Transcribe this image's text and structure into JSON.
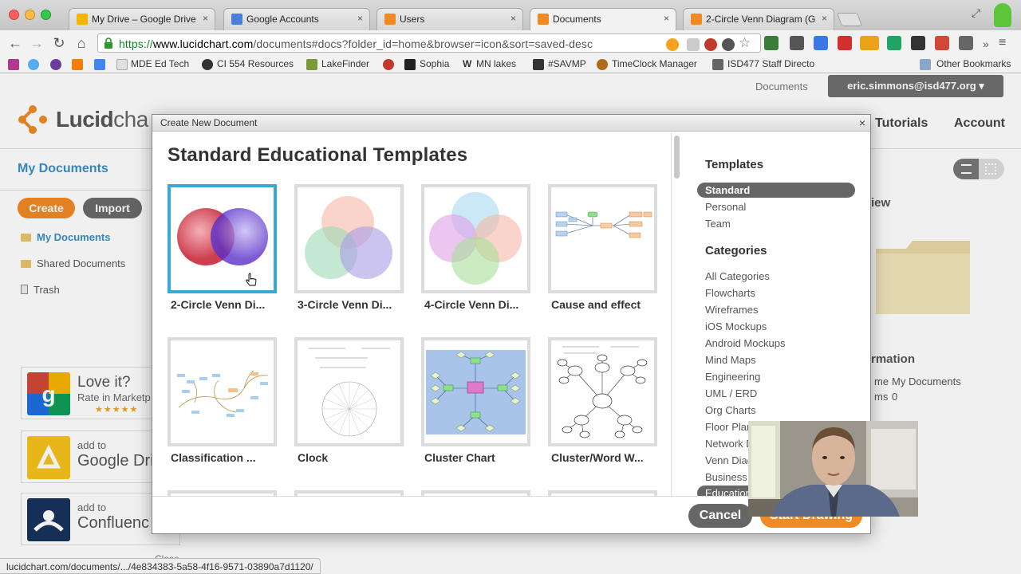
{
  "browser": {
    "tabs": [
      {
        "label": "My Drive – Google Drive",
        "favicon_color": "#f4b400"
      },
      {
        "label": "Google Accounts",
        "favicon_color": "#4a7fd8"
      },
      {
        "label": "Users",
        "favicon_color": "#f08a24"
      },
      {
        "label": "Documents",
        "favicon_color": "#f08a24",
        "active": true
      },
      {
        "label": "2-Circle Venn Diagram (G",
        "favicon_color": "#f08a24"
      }
    ],
    "url": {
      "scheme": "https://",
      "host": "www.lucidchart.com",
      "path": "/documents#docs?folder_id=home&browser=icon&sort=saved-desc"
    },
    "bookmarks": [
      {
        "label": "MDE Ed Tech",
        "icon": "page-icon"
      },
      {
        "label": "CI 554 Resources",
        "icon": "s-icon"
      },
      {
        "label": "LakeFinder",
        "icon": "lake-icon"
      },
      {
        "label": "",
        "icon": "red-icon"
      },
      {
        "label": "Sophia",
        "icon": "sophia-icon"
      },
      {
        "label": "MN lakes",
        "icon": "w-icon"
      },
      {
        "label": "#SAVMP",
        "icon": "savmp-icon"
      },
      {
        "label": "TimeClock Manager",
        "icon": "clock-icon"
      },
      {
        "label": "ISD477 Staff Directo",
        "icon": "isd-icon"
      }
    ],
    "other_bookmarks": "Other Bookmarks",
    "status_url": "lucidchart.com/documents/.../4e834383-5a58-4f16-9571-03890a7d1120/"
  },
  "page": {
    "docs_link": "Documents",
    "user_email": "eric.simmons@isd477.org ▾",
    "logo": {
      "bold": "Lucid",
      "thin": "cha"
    },
    "nav": {
      "tutorials": "Tutorials",
      "account": "Account"
    },
    "sidebar": {
      "title": "My Documents",
      "create": "Create",
      "import": "Import",
      "items": [
        {
          "label": "My Documents"
        },
        {
          "label": "Shared Documents"
        },
        {
          "label": "Trash"
        }
      ],
      "promos": [
        {
          "small": "Love it?",
          "big_small": "Rate in Marketp",
          "stars": "★★★★★"
        },
        {
          "small": "add to",
          "big": "Google Dri"
        },
        {
          "small": "add to",
          "big": "Confluenc"
        }
      ],
      "close_frag": "Close"
    },
    "right": {
      "view_frag": "iew",
      "info_title_frag": "rmation",
      "name_label_frag": "me",
      "name_value": "My Documents",
      "items_label_frag": "ms",
      "items_value": "0"
    }
  },
  "modal": {
    "titlebar": "Create New Document",
    "close": "×",
    "heading": "Standard Educational Templates",
    "templates": [
      {
        "label": "2-Circle Venn Di...",
        "kind": "venn2",
        "selected": true
      },
      {
        "label": "3-Circle Venn Di...",
        "kind": "venn3"
      },
      {
        "label": "4-Circle Venn Di...",
        "kind": "venn4"
      },
      {
        "label": "Cause and effect",
        "kind": "cause"
      },
      {
        "label": "Classification ...",
        "kind": "classification"
      },
      {
        "label": "Clock",
        "kind": "clock"
      },
      {
        "label": "Cluster Chart",
        "kind": "cluster"
      },
      {
        "label": "Cluster/Word W...",
        "kind": "word"
      }
    ],
    "sidebar": {
      "templates_head": "Templates",
      "template_types": [
        "Standard",
        "Personal",
        "Team"
      ],
      "categories_head": "Categories",
      "categories": [
        "All Categories",
        "Flowcharts",
        "Wireframes",
        "iOS Mockups",
        "Android Mockups",
        "Mind Maps",
        "Engineering",
        "UML / ERD",
        "Org Charts",
        "Floor Plan",
        "Network D",
        "Venn Diag",
        "Business A",
        "Education"
      ]
    },
    "footer": {
      "cancel": "Cancel",
      "start": "Start Drawing"
    }
  }
}
